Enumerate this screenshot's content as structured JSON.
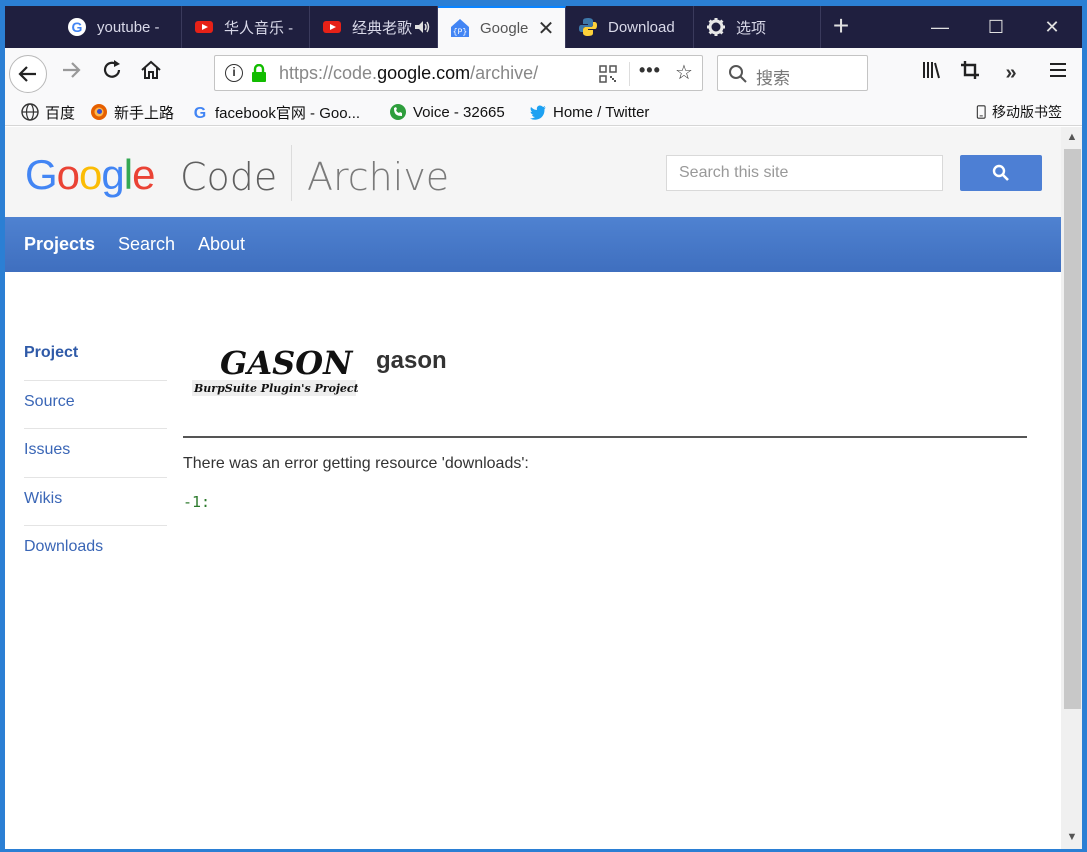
{
  "browser": {
    "tabs": [
      {
        "label": "youtube -",
        "icon": "google-icon"
      },
      {
        "label": "华人音乐 -",
        "icon": "youtube-icon"
      },
      {
        "label": "经典老歌",
        "icon": "youtube-icon",
        "audio": true
      },
      {
        "label": "Google",
        "icon": "google-code-icon",
        "active": true
      },
      {
        "label": "Download",
        "icon": "python-icon"
      },
      {
        "label": "选项",
        "icon": "gear-icon"
      }
    ],
    "new_tab": "+",
    "url": {
      "prefix": "https://code.",
      "domain": "google.com",
      "path": "/archive/"
    },
    "search_placeholder": "搜索",
    "bookmarks": [
      {
        "label": "百度",
        "icon": "globe-icon"
      },
      {
        "label": "新手上路",
        "icon": "firefox-icon"
      },
      {
        "label": "facebook官网 - Goo...",
        "icon": "google-icon"
      },
      {
        "label": "Voice - 32665",
        "icon": "voice-icon"
      },
      {
        "label": "Home / Twitter",
        "icon": "twitter-icon"
      },
      {
        "label": "移动版书签",
        "icon": "mobile-icon"
      }
    ]
  },
  "site": {
    "logo_google": "Google",
    "logo_code": "Code",
    "logo_archive": "Archive",
    "search_placeholder": "Search this site",
    "nav": [
      {
        "label": "Projects",
        "active": true
      },
      {
        "label": "Search"
      },
      {
        "label": "About"
      }
    ],
    "sidebar": [
      {
        "label": "Project",
        "active": true
      },
      {
        "label": "Source"
      },
      {
        "label": "Issues"
      },
      {
        "label": "Wikis"
      },
      {
        "label": "Downloads"
      }
    ],
    "project_logo_text": "GASON",
    "project_logo_subtext": "BurpSuite Plugin's Project",
    "project_name": "gason",
    "error_message": "There was an error getting resource 'downloads':",
    "error_code": "-1:"
  },
  "colors": {
    "tabbar_bg": "#1f1f3f",
    "nav_blue": "#4f82d1",
    "link_blue": "#3a66b6",
    "error_code_green": "#2c7a2c"
  }
}
